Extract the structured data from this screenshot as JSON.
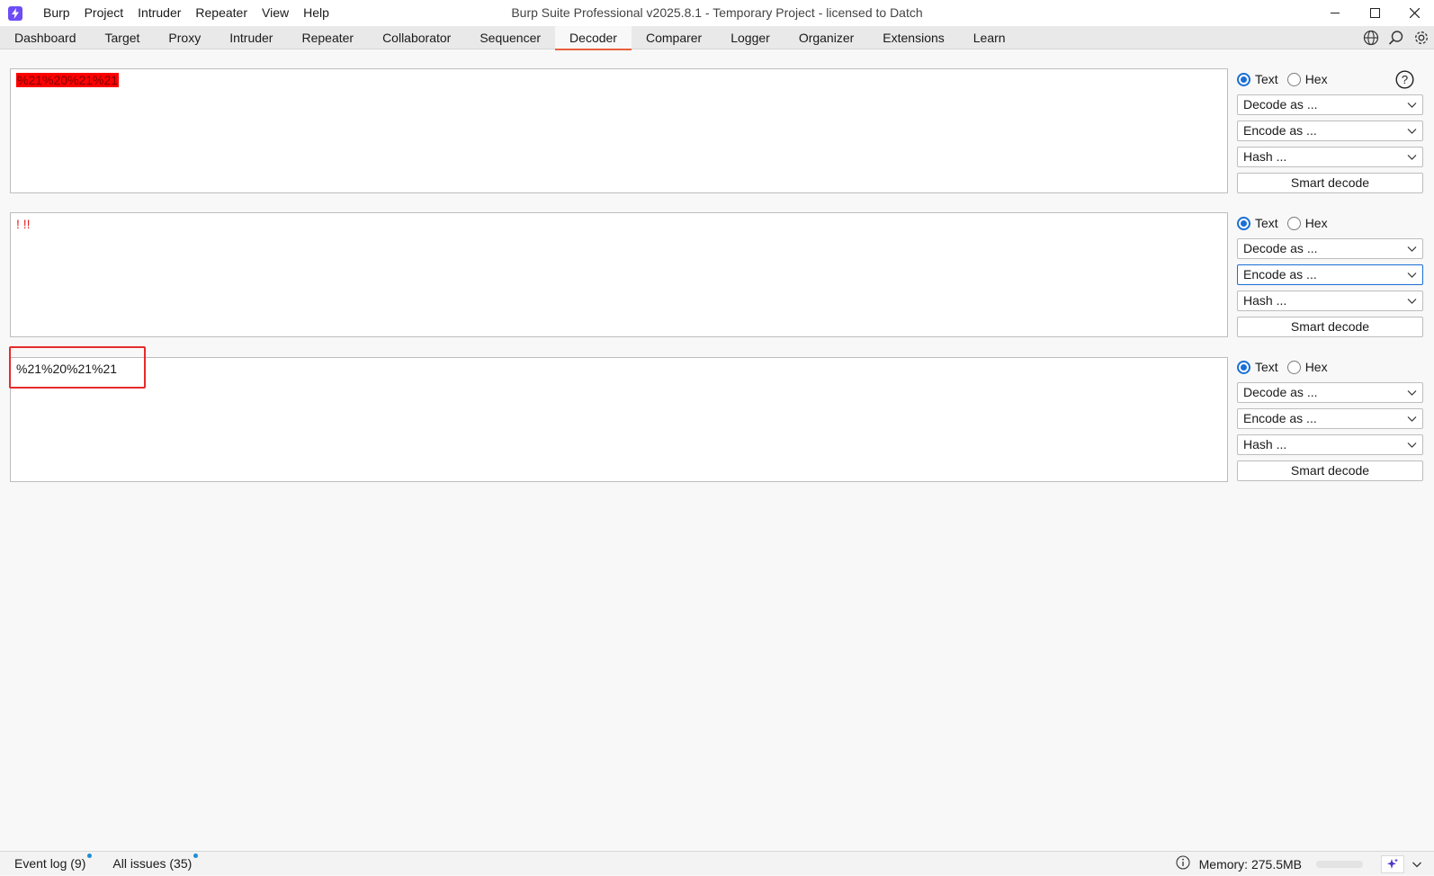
{
  "window": {
    "title": "Burp Suite Professional v2025.8.1 - Temporary Project - licensed to Datch",
    "menu": [
      "Burp",
      "Project",
      "Intruder",
      "Repeater",
      "View",
      "Help"
    ]
  },
  "tabs": [
    "Dashboard",
    "Target",
    "Proxy",
    "Intruder",
    "Repeater",
    "Collaborator",
    "Sequencer",
    "Decoder",
    "Comparer",
    "Logger",
    "Organizer",
    "Extensions",
    "Learn"
  ],
  "active_tab": "Decoder",
  "decoder": {
    "panels": [
      {
        "content": "%21%20%21%21"
      },
      {
        "content": "! !!"
      },
      {
        "content": "%21%20%21%21"
      }
    ],
    "controls": {
      "text_label": "Text",
      "hex_label": "Hex",
      "decode_label": "Decode as ...",
      "encode_label": "Encode as ...",
      "hash_label": "Hash ...",
      "smart_decode_label": "Smart decode"
    }
  },
  "status": {
    "event_log": "Event log (9)",
    "all_issues": "All issues (35)",
    "memory": "Memory: 275.5MB"
  },
  "colors": {
    "accent": "#e8603c",
    "highlight": "#ff0000",
    "annotation": "#e52b2b",
    "radio": "#1a6fd6",
    "brand": "#6e4cf5"
  }
}
